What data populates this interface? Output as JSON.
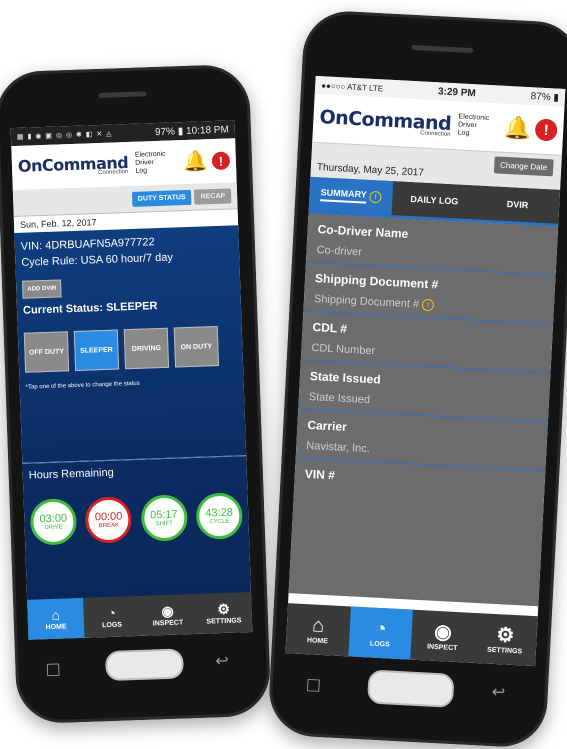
{
  "left_phone": {
    "statusbar": {
      "icons": "▦ ▮ ◉ ▣ ◎ ◎ ✱ ◧ ✕ ◬",
      "battery": "97%",
      "time": "10:18 PM"
    },
    "header": {
      "logo": "OnCommand",
      "logo_sub": "Connection",
      "side_label_1": "Electronic",
      "side_label_2": "Driver",
      "side_label_3": "Log"
    },
    "tabs": {
      "duty_status": "DUTY STATUS",
      "recap": "RECAP"
    },
    "date": "Sun, Feb. 12, 2017",
    "vin": "VIN: 4DRBUAFN5A977722",
    "cycle_rule": "Cycle Rule: USA 60 hour/7 day",
    "add_dvir": "ADD DVIR",
    "current_status": "Current Status: SLEEPER",
    "status_buttons": [
      "OFF DUTY",
      "SLEEPER",
      "DRIVING",
      "ON DUTY"
    ],
    "hint": "*Tap one of the above to change the status",
    "hours_title": "Hours Remaining",
    "hours": [
      {
        "time": "03:00",
        "label": "DRIVE"
      },
      {
        "time": "00:00",
        "label": "BREAK"
      },
      {
        "time": "05:17",
        "label": "SHIFT"
      },
      {
        "time": "43:28",
        "label": "CYCLE"
      }
    ],
    "nav": [
      "HOME",
      "LOGS",
      "INSPECT",
      "SETTINGS"
    ]
  },
  "right_phone": {
    "statusbar": {
      "carrier": "●●○○○ AT&T LTE",
      "time": "3:29 PM",
      "battery": "87%"
    },
    "header": {
      "logo": "OnCommand",
      "logo_sub": "Connection",
      "side_label_1": "Electronic",
      "side_label_2": "Driver",
      "side_label_3": "Log",
      "change_date": "Change Date"
    },
    "date": "Thursday, May 25, 2017",
    "tabs": [
      "SUMMARY",
      "DAILY LOG",
      "DVIR"
    ],
    "fields": [
      {
        "label": "Co-Driver Name",
        "placeholder": "Co-driver"
      },
      {
        "label": "Shipping Document #",
        "placeholder": "Shipping Document #"
      },
      {
        "label": "CDL #",
        "placeholder": "CDL Number"
      },
      {
        "label": "State Issued",
        "placeholder": "State Issued"
      },
      {
        "label": "Carrier",
        "placeholder": "Navistar, Inc."
      },
      {
        "label": "VIN #",
        "placeholder": ""
      }
    ],
    "nav": [
      "HOME",
      "LOGS",
      "INSPECT",
      "SETTINGS"
    ]
  },
  "colors": {
    "brand_blue": "#0f3e7e",
    "accent_blue": "#2a8be0",
    "alert_red": "#d62222",
    "panel_gray": "#6c6c6c"
  },
  "icons": {
    "notification": "bell-icon",
    "alert": "exclamation-icon",
    "home": "home-icon",
    "logs": "gauge-icon",
    "inspect": "eye-icon",
    "settings": "gear-icon"
  }
}
